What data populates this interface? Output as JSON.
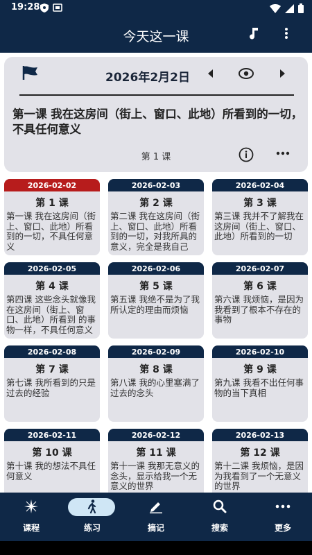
{
  "status": {
    "time": "19:28"
  },
  "appbar": {
    "title": "今天这一课"
  },
  "header": {
    "date": "2026年2月2日",
    "lesson_title": "第一课 我在这房间（街上、窗口、此地）所看到的一切，不具任何意义",
    "lesson_no": "第 1 课"
  },
  "cards": [
    {
      "date": "2026-02-02",
      "num": "第 1 课",
      "text": "第一课 我在这房间（街上、窗口、此地）所看到的一切，不具任何意义"
    },
    {
      "date": "2026-02-03",
      "num": "第 2 课",
      "text": "第二课 我在这房间（街上、窗口、此地）所看到的一切，对我所具的意义，完全是我自己"
    },
    {
      "date": "2026-02-04",
      "num": "第 3 课",
      "text": "第三课 我并不了解我在这房间（街上、窗口、此地）所看到的一切"
    },
    {
      "date": "2026-02-05",
      "num": "第 4 课",
      "text": "第四课 这些念头就像我在这房间（街上、窗口、此地）所看到 的事物一样，不具任何意义"
    },
    {
      "date": "2026-02-06",
      "num": "第 5 课",
      "text": "第五课 我绝不是为了我所认定的理由而烦恼"
    },
    {
      "date": "2026-02-07",
      "num": "第 6 课",
      "text": "第六课 我烦恼，是因为我看到了根本不存在的事物"
    },
    {
      "date": "2026-02-08",
      "num": "第 7 课",
      "text": "第七课 我所看到的只是过去的经验"
    },
    {
      "date": "2026-02-09",
      "num": "第 8 课",
      "text": "第八课 我的心里塞满了过去的念头"
    },
    {
      "date": "2026-02-10",
      "num": "第 9 课",
      "text": "第九课 我看不出任何事物的当下真相"
    },
    {
      "date": "2026-02-11",
      "num": "第 10 课",
      "text": "第十课 我的想法不具任何意义"
    },
    {
      "date": "2026-02-12",
      "num": "第 11 课",
      "text": "第十一课 我那无意义的念头，显示给我一个无意义的世界"
    },
    {
      "date": "2026-02-13",
      "num": "第 12 课",
      "text": "第十二课 我烦恼，是因为我看到了一个无意义的世界"
    }
  ],
  "nav": [
    {
      "label": "课程",
      "icon": "sparkle-icon"
    },
    {
      "label": "练习",
      "icon": "walking-icon"
    },
    {
      "label": "摘记",
      "icon": "pencil-icon"
    },
    {
      "label": "搜索",
      "icon": "search-icon"
    },
    {
      "label": "更多",
      "icon": "more-horiz-icon"
    }
  ],
  "active_nav": 1,
  "active_card": 0,
  "colors": {
    "primary": "#0f2847",
    "active_date": "#b71c1c",
    "card_bg": "#e2e2e8",
    "nav_pill": "#cfe6f5"
  }
}
